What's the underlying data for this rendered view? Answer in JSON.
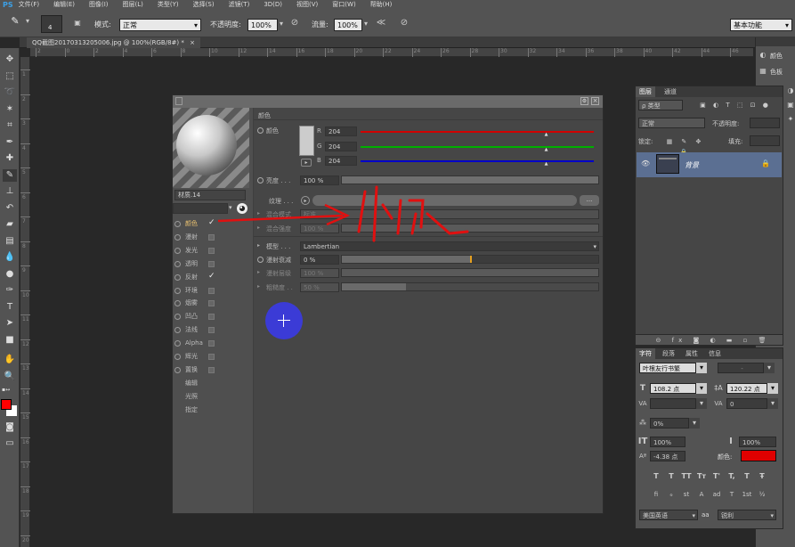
{
  "app": {
    "logo": "PS"
  },
  "menubar": {
    "items": [
      "文件(F)",
      "编辑(E)",
      "图像(I)",
      "图层(L)",
      "类型(Y)",
      "选择(S)",
      "滤镜(T)",
      "3D(D)",
      "视图(V)",
      "窗口(W)",
      "帮助(H)"
    ]
  },
  "options": {
    "brush_size": "4",
    "mode_label": "模式:",
    "mode_value": "正常",
    "opacity_label": "不透明度:",
    "opacity_value": "100%",
    "flow_label": "流量:",
    "flow_value": "100%",
    "workspace": "基本功能"
  },
  "document": {
    "tab_title": "QQ截图20170313205006.jpg @ 100%(RGB/8#) *"
  },
  "rulers": {
    "h": [
      "2",
      "0",
      "2",
      "4",
      "6",
      "8",
      "10",
      "12",
      "14",
      "16",
      "18",
      "20",
      "22",
      "24",
      "26",
      "28",
      "30",
      "32",
      "34",
      "36",
      "38",
      "40",
      "42",
      "44",
      "46"
    ],
    "v": [
      "1",
      "2",
      "3",
      "4",
      "5",
      "6",
      "7",
      "8",
      "9",
      "10",
      "11",
      "12",
      "13",
      "14",
      "15",
      "16",
      "17",
      "18",
      "19",
      "20"
    ]
  },
  "colors": {
    "foreground": "#ff0000",
    "background": "#ffffff",
    "accent_red": "#e00000",
    "layer_selected": "#5b6f92",
    "brush_blue": "#3b3bd6"
  },
  "material_dialog": {
    "material_name": "材质.14",
    "properties": [
      {
        "label": "颜色",
        "checked": true,
        "active": true,
        "has_dot": true
      },
      {
        "label": "漫射",
        "checked": false,
        "active": false,
        "has_dot": true
      },
      {
        "label": "发光",
        "checked": false,
        "active": false,
        "has_dot": true
      },
      {
        "label": "透明",
        "checked": false,
        "active": false,
        "has_dot": true
      },
      {
        "label": "反射",
        "checked": true,
        "active": false,
        "has_dot": true
      },
      {
        "label": "环境",
        "checked": false,
        "active": false,
        "has_dot": true
      },
      {
        "label": "烟雾",
        "checked": false,
        "active": false,
        "has_dot": true
      },
      {
        "label": "凹凸",
        "checked": false,
        "active": false,
        "has_dot": true
      },
      {
        "label": "法线",
        "checked": false,
        "active": false,
        "has_dot": true
      },
      {
        "label": "Alpha",
        "checked": false,
        "active": false,
        "has_dot": true
      },
      {
        "label": "辉光",
        "checked": false,
        "active": false,
        "has_dot": true
      },
      {
        "label": "置换",
        "checked": false,
        "active": false,
        "has_dot": true
      },
      {
        "label": "编辑",
        "checked": false,
        "active": false,
        "has_dot": false
      },
      {
        "label": "光照",
        "checked": false,
        "active": false,
        "has_dot": false
      },
      {
        "label": "指定",
        "checked": false,
        "active": false,
        "has_dot": false
      }
    ],
    "section_title": "颜色",
    "color_label": "颜色",
    "rgb": [
      {
        "channel": "R",
        "value": "204",
        "level": 0.8,
        "color": "#d00000"
      },
      {
        "channel": "G",
        "value": "204",
        "level": 0.8,
        "color": "#00b000"
      },
      {
        "channel": "B",
        "value": "204",
        "level": 0.8,
        "color": "#0000c8"
      }
    ],
    "brightness_label": "亮度 . . .",
    "brightness_value": "100 %",
    "brightness_level": 1.0,
    "texture_label": "纹理 . . .",
    "texture_button": "...",
    "blend_mode_label": "混合模式",
    "blend_mode_value": "标准",
    "blend_strength_label": "混合强度",
    "blend_strength_value": "100 %",
    "model_label": "模型 . . .",
    "model_value": "Lambertian",
    "diffuse_falloff_label": "漫射衰减",
    "diffuse_falloff_value": "0 %",
    "diffuse_falloff_level": 0.5,
    "diffuse_level_label": "漫射层级",
    "diffuse_level_value": "100 %",
    "roughness_label": "粗糙度 . .",
    "roughness_value": "50 %",
    "roughness_level": 0.25
  },
  "annotation": {
    "text": "外观"
  },
  "layers_panel": {
    "tabs": [
      "图层",
      "通道"
    ],
    "filter": "ρ 类型",
    "blend": "正常",
    "opacity_label": "不透明度:",
    "lock_label": "锁定:",
    "fill_label": "填充:",
    "layer_name": "背景"
  },
  "character_panel": {
    "tabs": [
      "字符",
      "段落",
      "属性",
      "信息"
    ],
    "font_family": "叶根友行书繁",
    "font_style": "-",
    "font_size": "108.2 点",
    "leading": "120.22 点",
    "kerning": "",
    "tracking": "0",
    "tsume": "0%",
    "vscale": "100%",
    "hscale": "100%",
    "baseline": "-4.38 点",
    "color_label": "颜色:",
    "style_buttons": [
      "T",
      "T",
      "TT",
      "Tт",
      "T'",
      "T,",
      "T",
      "Ŧ"
    ],
    "ot_buttons": [
      "fi",
      "ℴ",
      "st",
      "A",
      "ad",
      "T",
      "1st",
      "½"
    ],
    "language": "美国英语",
    "aa_icon": "aa",
    "antialias": "锐利"
  },
  "right_dock": {
    "items": [
      "颜色",
      "色板"
    ]
  }
}
